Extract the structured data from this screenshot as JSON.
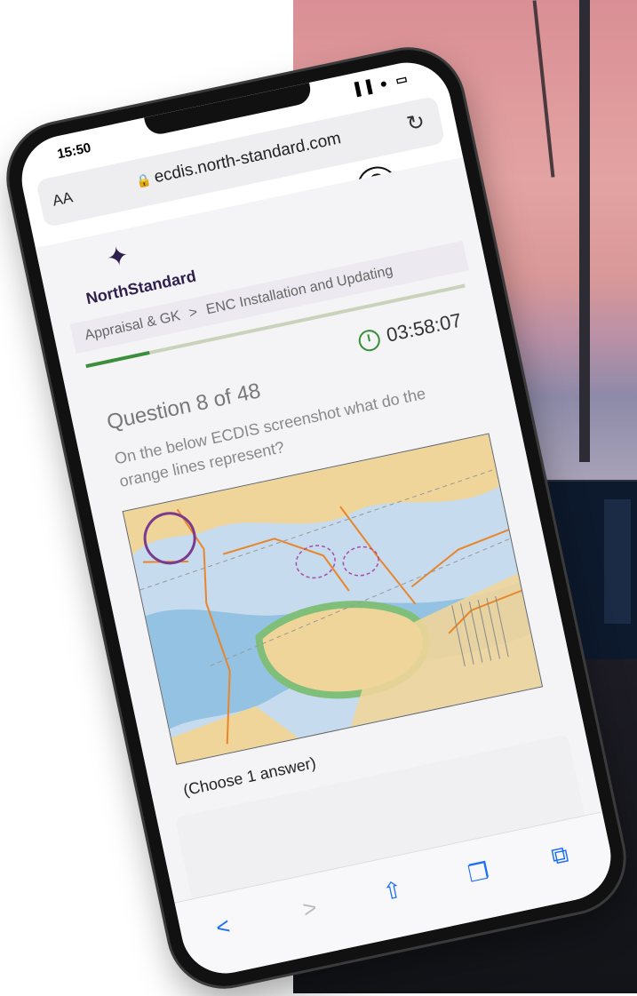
{
  "status": {
    "time": "15:50",
    "icons": "▐▐ ● ▭"
  },
  "browser": {
    "text_size_label": "AA",
    "url": "ecdis.north-standard.com",
    "reload_icon": "reload-icon"
  },
  "brand": {
    "mark": "✦",
    "name": "NorthStandard"
  },
  "breadcrumb": {
    "parent": "Appraisal & GK",
    "separator": ">",
    "current": "ENC Installation and Updating"
  },
  "progress": {
    "current": 8,
    "total": 48,
    "fraction": 0.167,
    "fill_color": "#3b8f3a",
    "track_color": "#c9d3bb"
  },
  "timer": {
    "value": "03:58:07"
  },
  "question": {
    "title": "Question 8 of 48",
    "text": "On the below ECDIS screenshot what do the orange lines represent?",
    "instruction": "(Choose 1 answer)"
  },
  "toolbar": {
    "back": "<",
    "forward": ">",
    "share": "⇧",
    "bookmarks": "❐",
    "tabs": "⧉"
  }
}
